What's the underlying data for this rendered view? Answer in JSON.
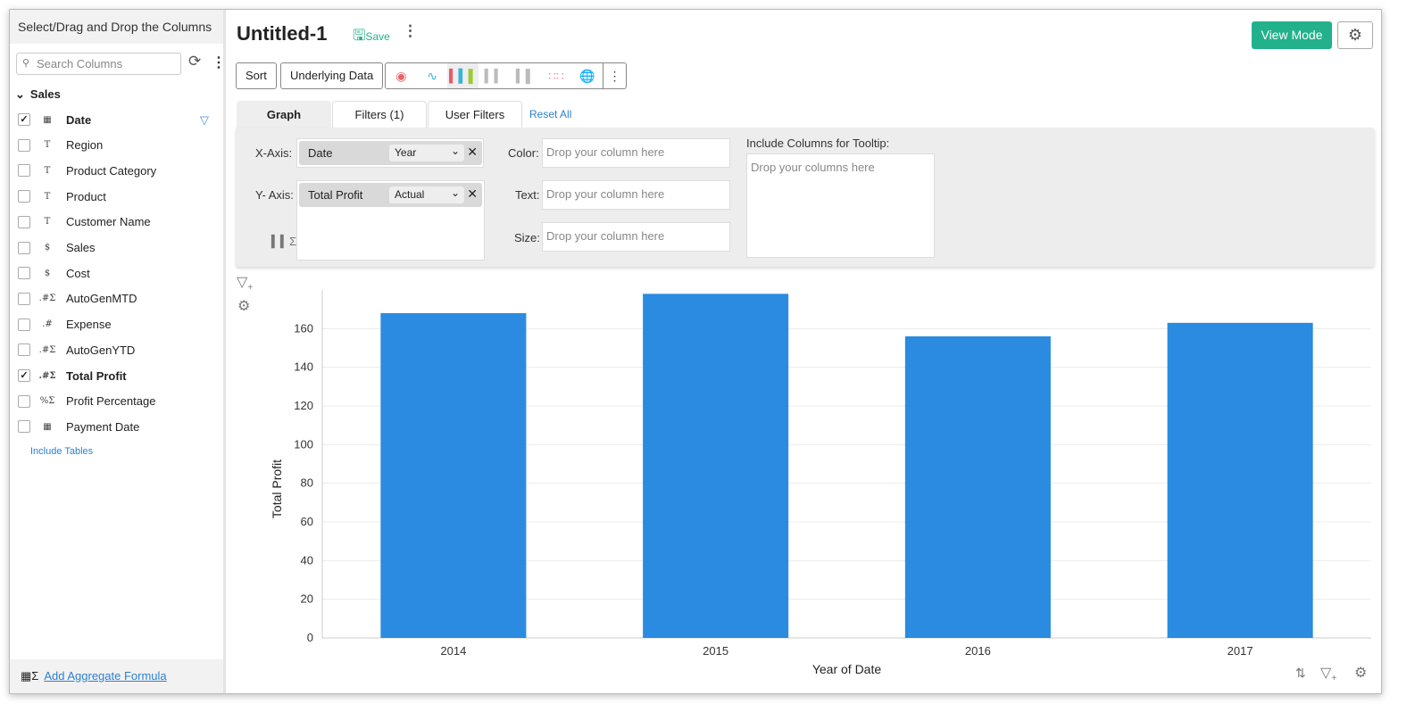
{
  "sidebar": {
    "header": "Select/Drag and Drop the Columns",
    "search_placeholder": "Search Columns",
    "group": "Sales",
    "columns": [
      {
        "label": "Date",
        "type": "date",
        "type_glyph": "▦",
        "checked": true,
        "filtered": true
      },
      {
        "label": "Region",
        "type": "text",
        "type_glyph": "T",
        "checked": false
      },
      {
        "label": "Product Category",
        "type": "text",
        "type_glyph": "T",
        "checked": false
      },
      {
        "label": "Product",
        "type": "text",
        "type_glyph": "T",
        "checked": false
      },
      {
        "label": "Customer Name",
        "type": "text",
        "type_glyph": "T",
        "checked": false
      },
      {
        "label": "Sales",
        "type": "currency",
        "type_glyph": "$",
        "checked": false
      },
      {
        "label": "Cost",
        "type": "currency",
        "type_glyph": "$",
        "checked": false
      },
      {
        "label": "AutoGenMTD",
        "type": "aggregate-number",
        "type_glyph": ".#Σ",
        "checked": false
      },
      {
        "label": "Expense",
        "type": "number",
        "type_glyph": ".#",
        "checked": false
      },
      {
        "label": "AutoGenYTD",
        "type": "aggregate-number",
        "type_glyph": ".#Σ",
        "checked": false
      },
      {
        "label": "Total Profit",
        "type": "aggregate-number",
        "type_glyph": ".#Σ",
        "checked": true
      },
      {
        "label": "Profit Percentage",
        "type": "aggregate-percent",
        "type_glyph": "%Σ",
        "checked": false
      },
      {
        "label": "Payment Date",
        "type": "date",
        "type_glyph": "▦",
        "checked": false
      }
    ],
    "include_tables": "Include Tables",
    "add_aggregate": "Add Aggregate Formula"
  },
  "header": {
    "title": "Untitled-1",
    "save": "Save",
    "view_mode": "View Mode"
  },
  "toolbar": {
    "sort": "Sort",
    "underlying": "Underlying Data",
    "chart_types": [
      "pie",
      "line",
      "bar",
      "stacked-bar",
      "waterfall",
      "scatter",
      "map"
    ],
    "selected_type": "bar"
  },
  "tabs": [
    {
      "label": "Graph",
      "active": true
    },
    {
      "label": "Filters (1)"
    },
    {
      "label": "User Filters"
    }
  ],
  "reset_all": "Reset All",
  "shelves": {
    "x_label": "X-Axis:",
    "x_column": "Date",
    "x_agg": "Year",
    "y_label": "Y- Axis:",
    "y_column": "Total Profit",
    "y_agg": "Actual",
    "color_label": "Color:",
    "text_label": "Text:",
    "size_label": "Size:",
    "drop_placeholder": "Drop your column here",
    "tooltip_label": "Include Columns for Tooltip:",
    "tooltip_placeholder": "Drop your columns here"
  },
  "colors": {
    "accent": "#22b18b",
    "bar": "#2a8be0",
    "link": "#2d7fd0"
  },
  "chart_data": {
    "type": "bar",
    "categories": [
      "2014",
      "2015",
      "2016",
      "2017"
    ],
    "values": [
      168,
      178,
      156,
      163
    ],
    "xlabel": "Year of Date",
    "ylabel": "Total Profit",
    "ylim": [
      0,
      180
    ],
    "yticks": [
      0,
      20,
      40,
      60,
      80,
      100,
      120,
      140,
      160
    ],
    "grid": true
  }
}
